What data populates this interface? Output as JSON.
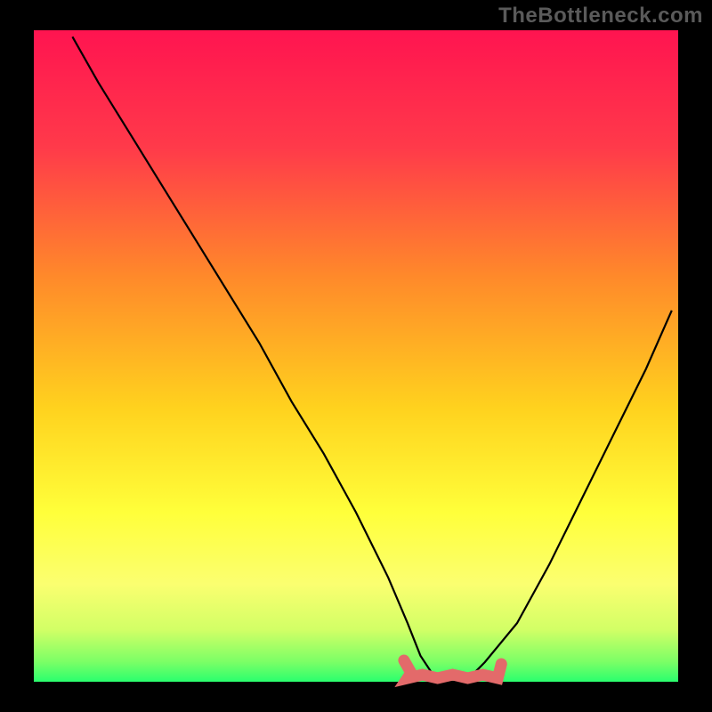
{
  "watermark": "TheBottleneck.com",
  "colors": {
    "black": "#000000",
    "curve": "#000000",
    "bottom_marker": "#e36a6a",
    "grad_top": "#ff1450",
    "grad_mid1": "#ff6a3a",
    "grad_mid2": "#ffd21e",
    "grad_mid3": "#fff26a",
    "grad_mid4": "#d9ff66",
    "grad_bottom": "#2aff6e"
  },
  "chart_data": {
    "type": "line",
    "title": "",
    "xlabel": "",
    "ylabel": "",
    "xlim": [
      0,
      100
    ],
    "ylim": [
      0,
      100
    ],
    "series": [
      {
        "name": "bottleneck-curve",
        "x": [
          6,
          10,
          15,
          20,
          25,
          30,
          35,
          40,
          45,
          50,
          55,
          58,
          60,
          62,
          64,
          66,
          68,
          70,
          75,
          80,
          85,
          90,
          95,
          99
        ],
        "y": [
          99,
          92,
          84,
          76,
          68,
          60,
          52,
          43,
          35,
          26,
          16,
          9,
          4,
          1,
          0,
          0,
          1,
          3,
          9,
          18,
          28,
          38,
          48,
          57
        ]
      }
    ],
    "flat_region": {
      "x_start": 58,
      "x_end": 72,
      "y": 0
    },
    "annotations": []
  }
}
